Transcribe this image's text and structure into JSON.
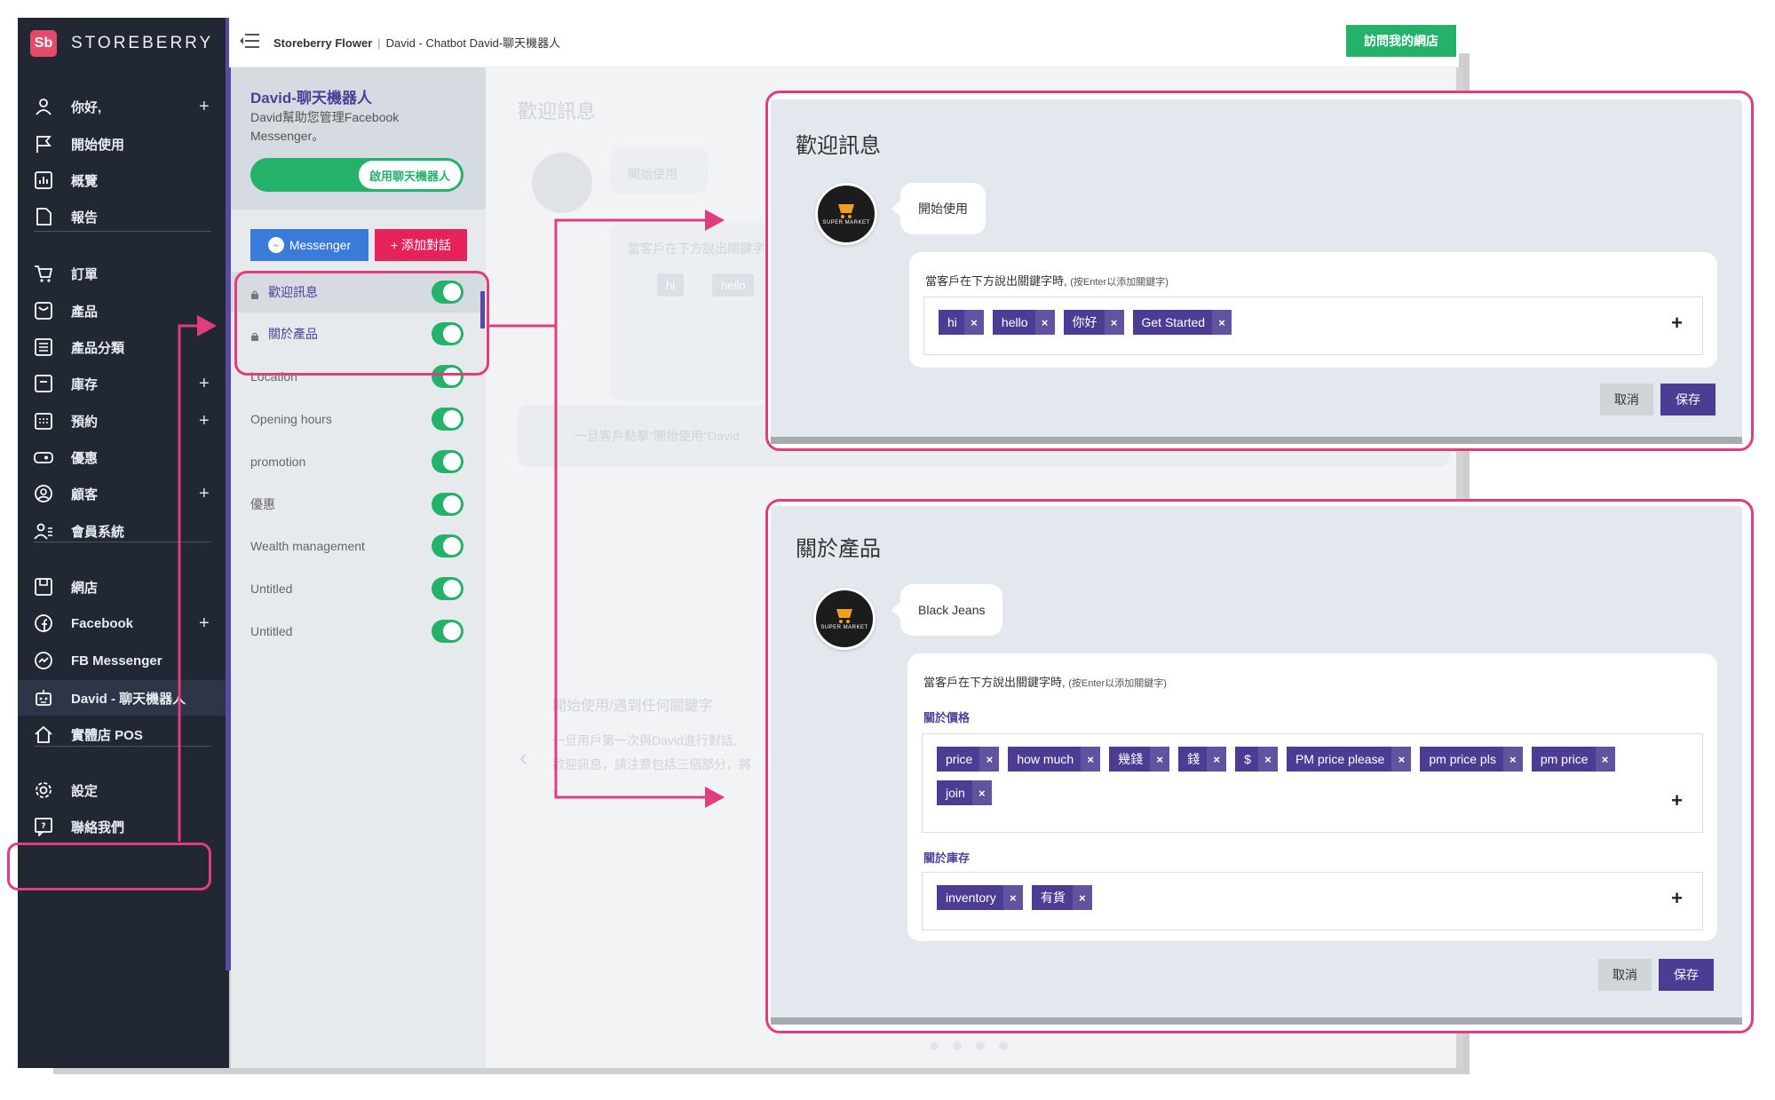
{
  "brand": {
    "name": "STOREBERRY",
    "logo_text": "Sb",
    "logo_color": "#e44a6a"
  },
  "nav": {
    "items": [
      {
        "label": "你好,",
        "icon": "user-icon",
        "plus": "+"
      },
      {
        "label": "開始使用",
        "icon": "flag-icon",
        "plus": ""
      },
      {
        "label": "概覽",
        "icon": "chart-icon",
        "plus": ""
      },
      {
        "label": "報告",
        "icon": "document-icon",
        "plus": ""
      },
      {
        "label": "訂單",
        "icon": "cart-icon",
        "plus": ""
      },
      {
        "label": "產品",
        "icon": "product-icon",
        "plus": ""
      },
      {
        "label": "產品分類",
        "icon": "list-icon",
        "plus": ""
      },
      {
        "label": "庫存",
        "icon": "inventory-icon",
        "plus": "+"
      },
      {
        "label": "預約",
        "icon": "calendar-icon",
        "plus": "+"
      },
      {
        "label": "優惠",
        "icon": "ticket-icon",
        "plus": ""
      },
      {
        "label": "顧客",
        "icon": "customer-icon",
        "plus": "+"
      },
      {
        "label": "會員系統",
        "icon": "members-icon",
        "plus": ""
      },
      {
        "label": "網店",
        "icon": "store-icon",
        "plus": ""
      },
      {
        "label": "Facebook",
        "icon": "facebook-icon",
        "plus": "+"
      },
      {
        "label": "FB Messenger",
        "icon": "messenger-icon",
        "plus": ""
      },
      {
        "label": "David - 聊天機器人",
        "icon": "robot-icon",
        "plus": ""
      },
      {
        "label": "實體店 POS",
        "icon": "home-icon",
        "plus": ""
      },
      {
        "label": "設定",
        "icon": "gear-icon",
        "plus": ""
      },
      {
        "label": "聯絡我們",
        "icon": "chat-icon",
        "plus": ""
      }
    ]
  },
  "topbar": {
    "store": "Storeberry Flower",
    "separator": "|",
    "crumb": "David - Chatbot David-聊天機器人",
    "visit_label": "訪問我的網店"
  },
  "bot": {
    "title": "David-聊天機器人",
    "desc": "David幫助您管理Facebook Messenger。",
    "enable_label": "啟用聊天機器人",
    "messenger_label": "Messenger",
    "add_dialog_label": "+ 添加對話",
    "dialogs": [
      {
        "label": "歡迎訊息",
        "locked": true,
        "on": true
      },
      {
        "label": "關於產品",
        "locked": true,
        "on": true
      },
      {
        "label": "Location",
        "locked": false,
        "on": true
      },
      {
        "label": "Opening hours",
        "locked": false,
        "on": true
      },
      {
        "label": "promotion",
        "locked": false,
        "on": true
      },
      {
        "label": "優惠",
        "locked": false,
        "on": true
      },
      {
        "label": "Wealth management",
        "locked": false,
        "on": true
      },
      {
        "label": "Untitled",
        "locked": false,
        "on": true
      },
      {
        "label": "Untitled",
        "locked": false,
        "on": true
      }
    ]
  },
  "background": {
    "heading": "歡迎訊息",
    "bubble": "開始使用",
    "kw_hint": "當客戶在下方說出關鍵字",
    "tags": [
      "hi",
      "hello"
    ],
    "info": "一旦客戶點擊\"開始使用\"David",
    "section2": "開始使用/遇到任何關鍵字",
    "section2_line1": "一旦用戶第一次與David進行對話,",
    "section2_line2": "歡迎訊息，請注意包括三個部分，將"
  },
  "popup_welcome": {
    "title": "歡迎訊息",
    "bot_bubble": "開始使用",
    "avatar_text": "SUPER MARKET",
    "kw_label": "當客戶在下方說出關鍵字時,",
    "kw_hint": "(按Enter以添加關鍵字)",
    "tags": [
      "hi",
      "hello",
      "你好",
      "Get Started"
    ],
    "add": "+",
    "cancel": "取消",
    "save": "保存"
  },
  "popup_product": {
    "title": "關於產品",
    "bot_bubble": "Black Jeans",
    "avatar_text": "SUPER MARKET",
    "kw_label": "當客戶在下方說出關鍵字時,",
    "kw_hint": "(按Enter以添加關鍵字)",
    "group1_label": "關於價格",
    "group1_tags": [
      "price",
      "how much",
      "幾錢",
      "錢",
      "$",
      "PM price please",
      "pm price pls",
      "pm price",
      "join"
    ],
    "group2_label": "關於庫存",
    "group2_tags": [
      "inventory",
      "有貨"
    ],
    "add": "+",
    "cancel": "取消",
    "save": "保存"
  },
  "colors": {
    "sidebar_bg": "#212834",
    "accent_purple": "#4c3c93",
    "highlight_pink": "#e13d7d",
    "green": "#24b26a",
    "red": "#e5225a",
    "messenger_blue": "#3a7ad9"
  }
}
